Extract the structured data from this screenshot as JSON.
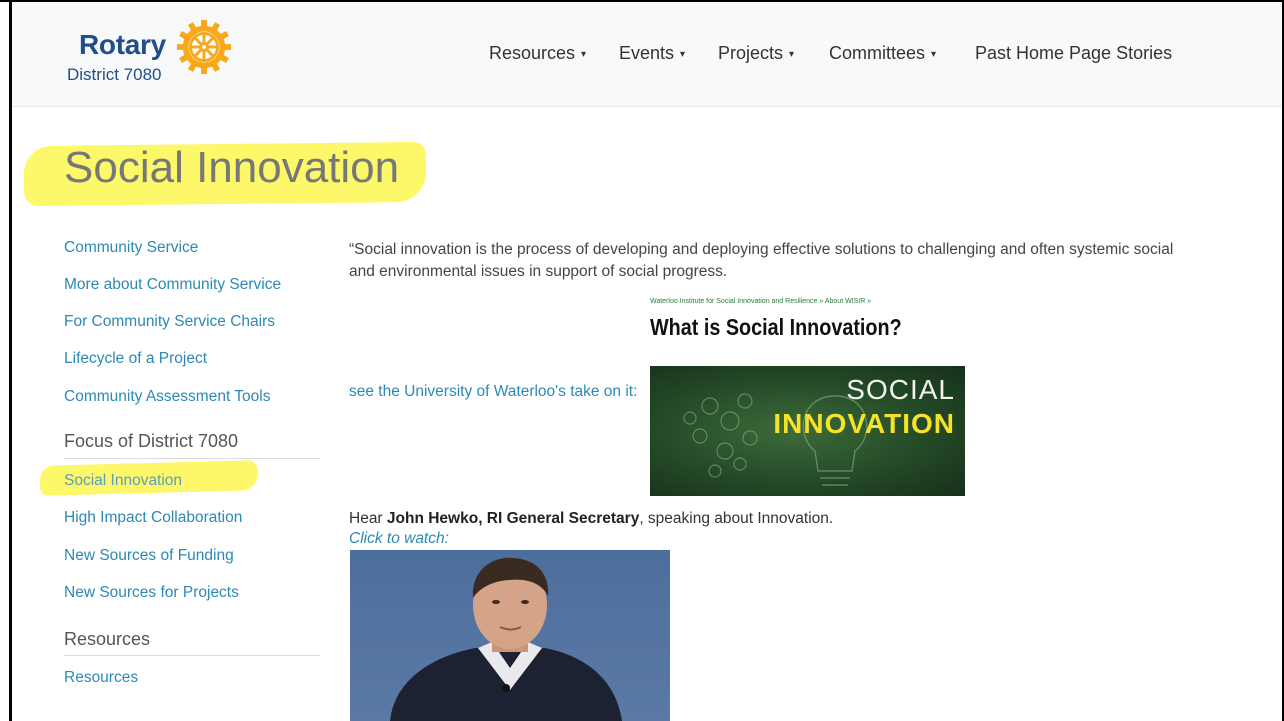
{
  "header": {
    "logo_word": "Rotary",
    "logo_district": "District 7080",
    "nav": [
      {
        "label": "Resources",
        "has_caret": true
      },
      {
        "label": "Events",
        "has_caret": true
      },
      {
        "label": "Projects",
        "has_caret": true
      },
      {
        "label": "Committees",
        "has_caret": true
      },
      {
        "label": "Past Home Page Stories",
        "has_caret": false
      }
    ],
    "caret_glyph": "▾"
  },
  "page_title": "Social Innovation",
  "sidebar": {
    "links_top": [
      "Community Service",
      "More about Community Service",
      "For Community Service Chairs",
      "Lifecycle of a Project",
      "Community Assessment Tools"
    ],
    "focus_heading": "Focus of District 7080",
    "focus_links": [
      "Social Innovation",
      "High Impact Collaboration",
      "New Sources of Funding",
      "New Sources for Projects"
    ],
    "resources_heading": "Resources",
    "resources_links": [
      "Resources"
    ]
  },
  "main": {
    "quote": "“Social innovation is the process of developing and deploying effective solutions to challenging and often systemic social and environmental issues in support of social progress.",
    "wisir_breadcrumb": "Waterloo Institute for Social Innovation and Resilience » About WISIR »",
    "wisir_title": "What is Social Innovation?",
    "see_link": "see the University of Waterloo's take on it:",
    "image_text_top": "SOCIAL",
    "image_text_bottom": "INNOVATION",
    "hear_prefix": "Hear ",
    "hear_bold": "John Hewko, RI General Secretary",
    "hear_suffix": ", speaking about Innovation.",
    "click_to_watch": "Click to watch:"
  },
  "colors": {
    "link": "#2b89b5",
    "highlight": "#fdf76a",
    "rotary_blue": "#1f4e8a",
    "rotary_gold": "#f7a81b"
  }
}
